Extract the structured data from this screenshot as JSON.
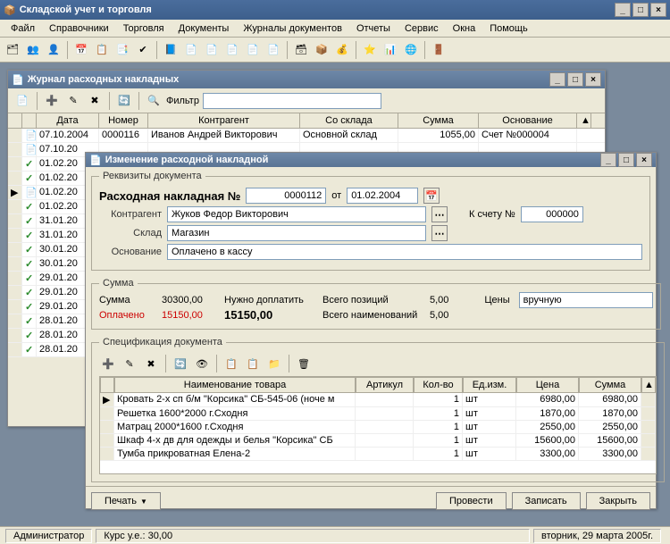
{
  "app": {
    "title": "Складской учет и торговля"
  },
  "menu": [
    "Файл",
    "Справочники",
    "Торговля",
    "Документы",
    "Журналы документов",
    "Отчеты",
    "Сервис",
    "Окна",
    "Помощь"
  ],
  "journal": {
    "title": "Журнал расходных накладных",
    "filter_label": "Фильтр",
    "headers": {
      "date": "Дата",
      "number": "Номер",
      "counterparty": "Контрагент",
      "warehouse": "Со склада",
      "sum": "Сумма",
      "basis": "Основание"
    },
    "rows": [
      {
        "sel": "",
        "date": "07.10.2004",
        "number": "0000116",
        "counterparty": "Иванов Андрей Викторович",
        "warehouse": "Основной склад",
        "sum": "1055,00",
        "basis": "Счет №000004"
      },
      {
        "sel": "",
        "date": "07.10.20"
      },
      {
        "sel": "✓",
        "date": "01.02.20"
      },
      {
        "sel": "✓",
        "date": "01.02.20"
      },
      {
        "sel": "▶",
        "date": "01.02.20"
      },
      {
        "sel": "✓",
        "date": "01.02.20"
      },
      {
        "sel": "✓",
        "date": "31.01.20"
      },
      {
        "sel": "✓",
        "date": "31.01.20"
      },
      {
        "sel": "✓",
        "date": "30.01.20"
      },
      {
        "sel": "✓",
        "date": "30.01.20"
      },
      {
        "sel": "✓",
        "date": "29.01.20"
      },
      {
        "sel": "✓",
        "date": "29.01.20"
      },
      {
        "sel": "✓",
        "date": "29.01.20"
      },
      {
        "sel": "✓",
        "date": "28.01.20"
      },
      {
        "sel": "✓",
        "date": "28.01.20"
      },
      {
        "sel": "✓",
        "date": "28.01.20"
      }
    ]
  },
  "edit": {
    "title": "Изменение расходной накладной",
    "req_legend": "Реквизиты документа",
    "heading": "Расходная накладная №",
    "number": "0000112",
    "from": "от",
    "date": "01.02.2004",
    "labels": {
      "counterparty": "Контрагент",
      "warehouse": "Склад",
      "basis": "Основание",
      "toaccount": "К счету №"
    },
    "counterparty": "Жуков Федор Викторович",
    "warehouse": "Магазин",
    "basis": "Оплачено в кассу",
    "account": "000000",
    "sum_legend": "Сумма",
    "sum_labels": {
      "sum": "Сумма",
      "paid": "Оплачено",
      "topay": "Нужно доплатить",
      "positions": "Всего позиций",
      "names": "Всего наименований",
      "prices": "Цены"
    },
    "sum": "30300,00",
    "paid": "15150,00",
    "topay": "15150,00",
    "positions": "5,00",
    "names": "5,00",
    "prices_mode": "вручную",
    "spec_legend": "Спецификация документа",
    "spec_headers": {
      "name": "Наименование товара",
      "art": "Артикул",
      "qty": "Кол-во",
      "unit": "Ед.изм.",
      "price": "Цена",
      "sum": "Сумма"
    },
    "spec_rows": [
      {
        "sel": "▶",
        "name": "Кровать 2-х сп б/м \"Корсика\" СБ-545-06 (ноче м",
        "art": "",
        "qty": "1",
        "unit": "шт",
        "price": "6980,00",
        "sum": "6980,00"
      },
      {
        "sel": "",
        "name": "Решетка 1600*2000 г.Сходня",
        "art": "",
        "qty": "1",
        "unit": "шт",
        "price": "1870,00",
        "sum": "1870,00"
      },
      {
        "sel": "",
        "name": "Матрац 2000*1600 г.Сходня",
        "art": "",
        "qty": "1",
        "unit": "шт",
        "price": "2550,00",
        "sum": "2550,00"
      },
      {
        "sel": "",
        "name": "Шкаф 4-х дв  для одежды и белья \"Корсика\" СБ",
        "art": "",
        "qty": "1",
        "unit": "шт",
        "price": "15600,00",
        "sum": "15600,00"
      },
      {
        "sel": "",
        "name": "Тумба прикроватная Елена-2",
        "art": "",
        "qty": "1",
        "unit": "шт",
        "price": "3300,00",
        "sum": "3300,00"
      }
    ],
    "buttons": {
      "print": "Печать",
      "commit": "Провести",
      "save": "Записать",
      "close": "Закрыть"
    }
  },
  "status": {
    "user": "Администратор",
    "rate": "Курс у.е.: 30,00",
    "date": "вторник, 29 марта 2005г."
  }
}
